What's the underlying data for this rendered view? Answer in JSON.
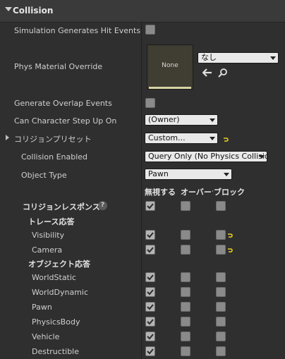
{
  "section": {
    "title": "Collision"
  },
  "properties": {
    "sim_hit": {
      "label": "Simulation Generates Hit Events",
      "checked": false
    },
    "phys_material": {
      "label": "Phys Material Override",
      "thumb_text": "None",
      "value": "なし",
      "back_icon": "arrow-left-icon",
      "search_icon": "search-icon"
    },
    "overlap": {
      "label": "Generate Overlap Events",
      "checked": false
    },
    "step_up": {
      "label": "Can Character Step Up On",
      "value": "(Owner)"
    },
    "preset": {
      "label": "コリジョンプリセット",
      "value": "Custom..."
    },
    "collision_enabled": {
      "label": "Collision Enabled",
      "value": "Query Only (No Physics Collision)"
    },
    "object_type": {
      "label": "Object Type",
      "value": "Pawn"
    }
  },
  "responses": {
    "columns": [
      "無視する",
      "オーバーラップ",
      "ブロック"
    ],
    "header_label": "コリジョンレスポンス",
    "help_icon": "?",
    "trace_label": "トレース応答",
    "object_label": "オブジェクト応答",
    "trace_rows": [
      {
        "label": "Visibility",
        "ignore": true,
        "overlap": false,
        "block": false,
        "reset": true
      },
      {
        "label": "Camera",
        "ignore": true,
        "overlap": false,
        "block": false,
        "reset": true
      }
    ],
    "object_rows": [
      {
        "label": "WorldStatic",
        "ignore": true,
        "overlap": false,
        "block": false
      },
      {
        "label": "WorldDynamic",
        "ignore": true,
        "overlap": false,
        "block": false
      },
      {
        "label": "Pawn",
        "ignore": true,
        "overlap": false,
        "block": false
      },
      {
        "label": "PhysicsBody",
        "ignore": true,
        "overlap": false,
        "block": false
      },
      {
        "label": "Vehicle",
        "ignore": true,
        "overlap": false,
        "block": false
      },
      {
        "label": "Destructible",
        "ignore": true,
        "overlap": false,
        "block": false
      }
    ]
  },
  "colors": {
    "reset_arrow": "#e8d21e",
    "panel_bg": "#2f2f2f",
    "header_bg": "#3a3a3a"
  }
}
